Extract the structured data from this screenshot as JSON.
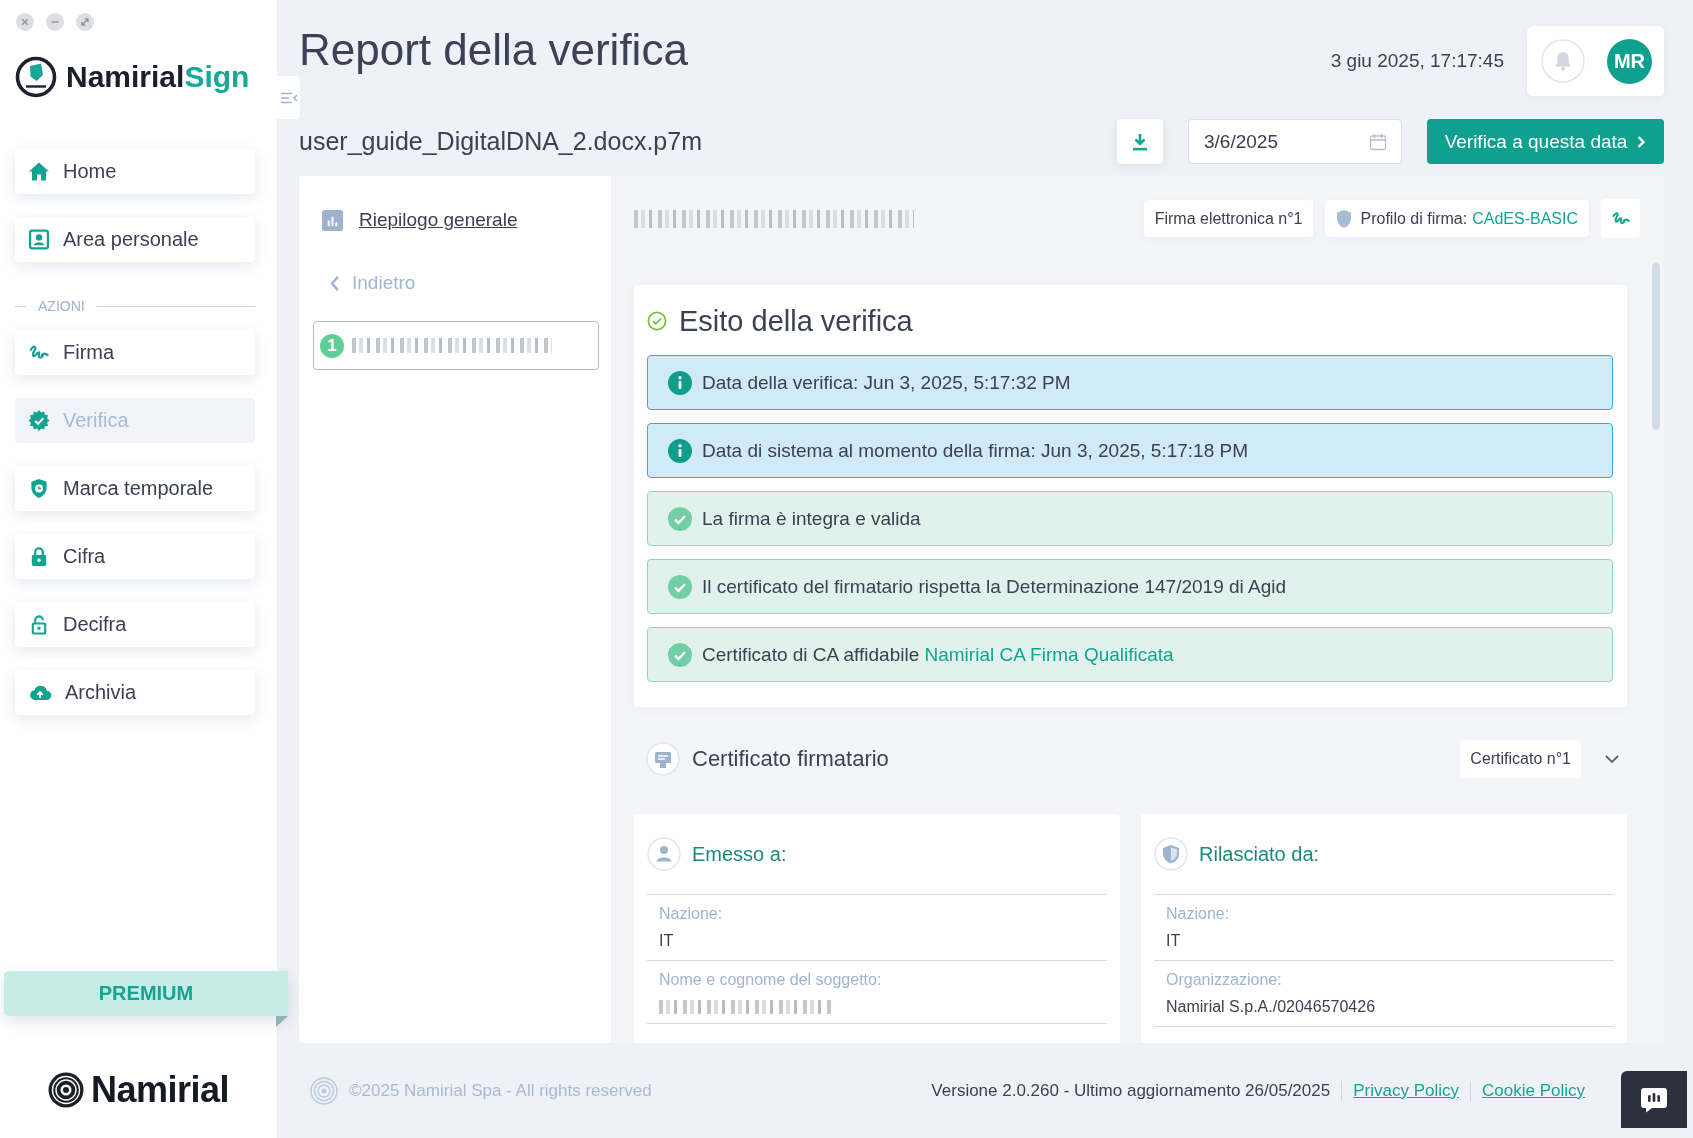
{
  "sidebar": {
    "logo": {
      "name": "Namirial",
      "accent": "Sign"
    },
    "nav": [
      {
        "label": "Home",
        "selected": false
      },
      {
        "label": "Area personale",
        "selected": false
      }
    ],
    "section_label": "AZIONI",
    "actions": [
      {
        "label": "Firma",
        "selected": false
      },
      {
        "label": "Verifica",
        "selected": true
      },
      {
        "label": "Marca temporale",
        "selected": false
      },
      {
        "label": "Cifra",
        "selected": false
      },
      {
        "label": "Decifra",
        "selected": false
      },
      {
        "label": "Archivia",
        "selected": false
      }
    ],
    "plan_badge": "PREMIUM",
    "brand": "Namirial"
  },
  "header": {
    "title": "Report della verifica",
    "timestamp": "3 giu 2025, 17:17:45",
    "user_initials": "MR",
    "filename": "user_guide_DigitalDNA_2.docx.p7m",
    "date_field": {
      "value": "3/6/2025"
    },
    "verify_button": "Verifica a questa data"
  },
  "report_nav": {
    "summary_link": "Riepilogo generale",
    "back_link": "Indietro",
    "signers": [
      {
        "number": "1",
        "selected": true,
        "name_redacted": true
      }
    ]
  },
  "signature_bar": {
    "signer_redacted": true,
    "signature_badge": "Firma elettronica n°1",
    "profile_label": "Profilo di firma:",
    "profile_value": "CAdES-BASIC"
  },
  "outcome": {
    "title": "Esito della verifica",
    "checks": [
      {
        "kind": "info",
        "text": "Data della verifica: Jun 3, 2025, 5:17:32 PM"
      },
      {
        "kind": "info",
        "text": "Data di sistema al momento della firma: Jun 3, 2025, 5:17:18 PM"
      },
      {
        "kind": "success",
        "text": "La firma è integra e valida"
      },
      {
        "kind": "success",
        "text": "Il certificato del firmatario rispetta la Determinazione 147/2019 di Agid"
      },
      {
        "kind": "success",
        "text": "Certificato di CA affidabile",
        "link": "Namirial CA Firma Qualificata"
      }
    ]
  },
  "certificate": {
    "title": "Certificato firmatario",
    "badge": "Certificato n°1",
    "panels": [
      {
        "kind": "subject",
        "title": "Emesso a:",
        "fields": [
          {
            "label": "Nazione:",
            "value": "IT",
            "redacted": false
          },
          {
            "label": "Nome e cognome del soggetto:",
            "redacted": true
          }
        ]
      },
      {
        "kind": "issuer",
        "title": "Rilasciato da:",
        "fields": [
          {
            "label": "Nazione:",
            "value": "IT",
            "redacted": false
          },
          {
            "label": "Organizzazione:",
            "value": "Namirial S.p.A./02046570426",
            "redacted": false
          }
        ]
      }
    ]
  },
  "footer": {
    "copyright": "©2025 Namirial Spa - All rights reserved",
    "version": "Versione 2.0.260 - Ultimo aggiornamento 26/05/2025",
    "links": [
      "Privacy Policy",
      "Cookie Policy"
    ]
  }
}
